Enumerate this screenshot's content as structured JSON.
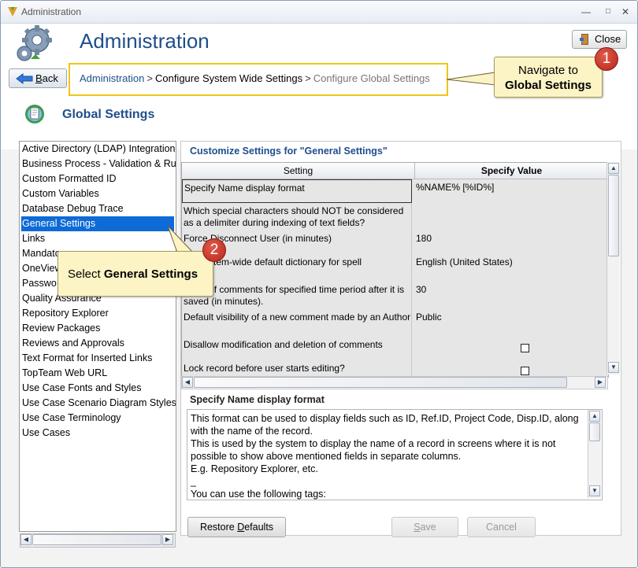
{
  "window": {
    "title": "Administration",
    "controls": [
      "minimize",
      "maximize",
      "close"
    ]
  },
  "header": {
    "title": "Administration",
    "close_label": "Close",
    "back_label": "Back"
  },
  "breadcrumb": {
    "items": [
      "Administration",
      "Configure System Wide Settings",
      "Configure Global Settings"
    ],
    "separator": ">"
  },
  "callouts": [
    {
      "number": "1",
      "line1": "Navigate to",
      "line2": "Global Settings"
    },
    {
      "number": "2",
      "prefix": "Select ",
      "bold": "General Settings"
    }
  ],
  "section": {
    "title": "Global Settings"
  },
  "left_list": {
    "selected_index": 5,
    "items": [
      "Active Directory (LDAP) Integration",
      "Business Process - Validation & Ru",
      "Custom Formatted ID",
      "Custom Variables",
      "Database Debug Trace",
      "General Settings",
      "Links",
      "Mandato",
      "OneView",
      "Passwo",
      "Quality Assurance",
      "Repository Explorer",
      "Review Packages",
      "Reviews and Approvals",
      "Text Format for Inserted Links",
      "TopTeam Web URL",
      "Use Case Fonts and Styles",
      "Use Case Scenario Diagram Styles",
      "Use Case Terminology",
      "Use Cases"
    ]
  },
  "settings_panel": {
    "title": "Customize Settings for \"General Settings\"",
    "columns": [
      "Setting",
      "Specify Value"
    ],
    "rows": [
      {
        "setting": "Specify Name display format",
        "value": "%NAME% [%ID%]"
      },
      {
        "setting": "Which special characters should NOT be considered as a delimiter during indexing of text fields?",
        "value": ""
      },
      {
        "setting": "Force Disconnect User (in minutes)",
        "value": "180"
      },
      {
        "setting": "the system-wide default dictionary for spell",
        "value": "English (United States)"
      },
      {
        "setting": "diting of comments for specified time period after it is saved (in minutes).",
        "value": "30"
      },
      {
        "setting": "Default visibility of a new comment made by an Author",
        "value": "Public"
      },
      {
        "setting": "Disallow modification and deletion of comments",
        "value": "",
        "checkbox": true,
        "checked": false
      },
      {
        "setting": "Lock record before user starts editing?",
        "value": "",
        "checkbox": true,
        "checked": false
      }
    ]
  },
  "description": {
    "title": "Specify Name display format",
    "paragraphs": [
      "This format can be used to display fields such as ID, Ref.ID, Project Code, Disp.ID, along with the name of the record.",
      "This is used by the system to display the name of a record in screens where it is not possible to show above mentioned fields in separate columns.",
      "E.g. Repository Explorer, etc.",
      "_",
      "You can use the following tags:"
    ]
  },
  "footer": {
    "restore_label": "Restore Defaults",
    "save_label": "Save",
    "cancel_label": "Cancel"
  },
  "colors": {
    "accent": "#1f4e8c",
    "selection": "#0e6ad6",
    "callout_bg": "#fdf4c5",
    "badge": "#c0392b",
    "breadcrumb_border": "#f0c419"
  }
}
